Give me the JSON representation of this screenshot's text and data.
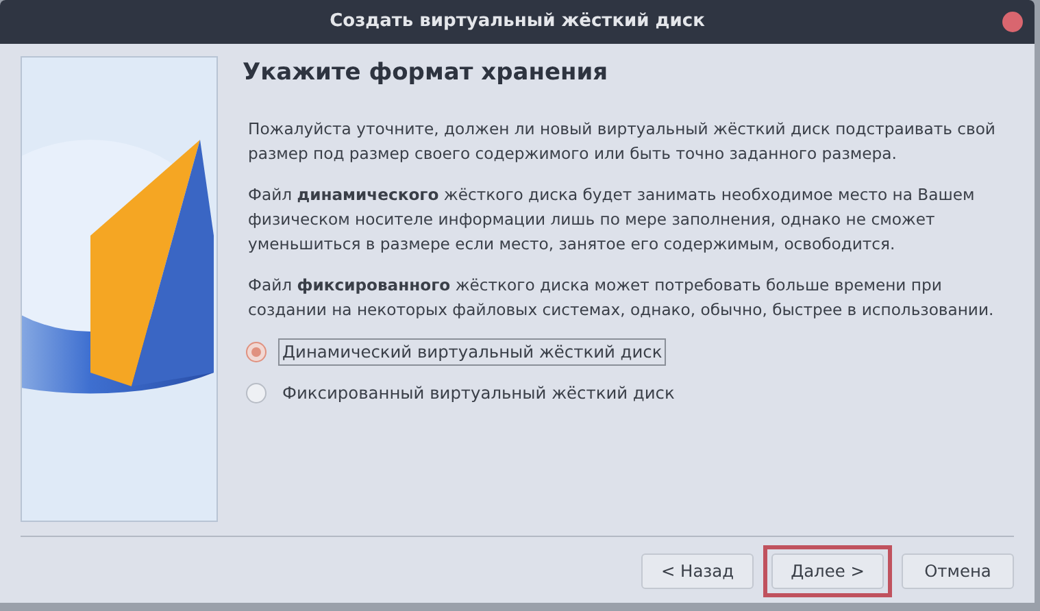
{
  "window": {
    "title": "Создать виртуальный жёсткий диск"
  },
  "heading": "Укажите формат хранения",
  "paragraphs": [
    "Пожалуйста уточните, должен ли новый виртуальный жёсткий диск подстраивать свой размер под размер своего содержимого или быть точно заданного размера.",
    "Файл **динамического** жёсткого диска будет занимать необходимое место на Вашем физическом носителе информации лишь по мере заполнения, однако не сможет уменьшиться в размере если место, занятое его содержимым, освободится.",
    "Файл **фиксированного** жёсткого диска может потребовать больше времени при создании на некоторых файловых системах, однако, обычно, быстрее в использовании."
  ],
  "options": [
    {
      "label": "Динамический виртуальный жёсткий диск",
      "selected": true
    },
    {
      "label": "Фиксированный виртуальный жёсткий диск",
      "selected": false
    }
  ],
  "buttons": [
    {
      "label": "< Назад",
      "highlighted": false
    },
    {
      "label": "Далее >",
      "highlighted": true
    },
    {
      "label": "Отмена",
      "highlighted": false
    }
  ]
}
